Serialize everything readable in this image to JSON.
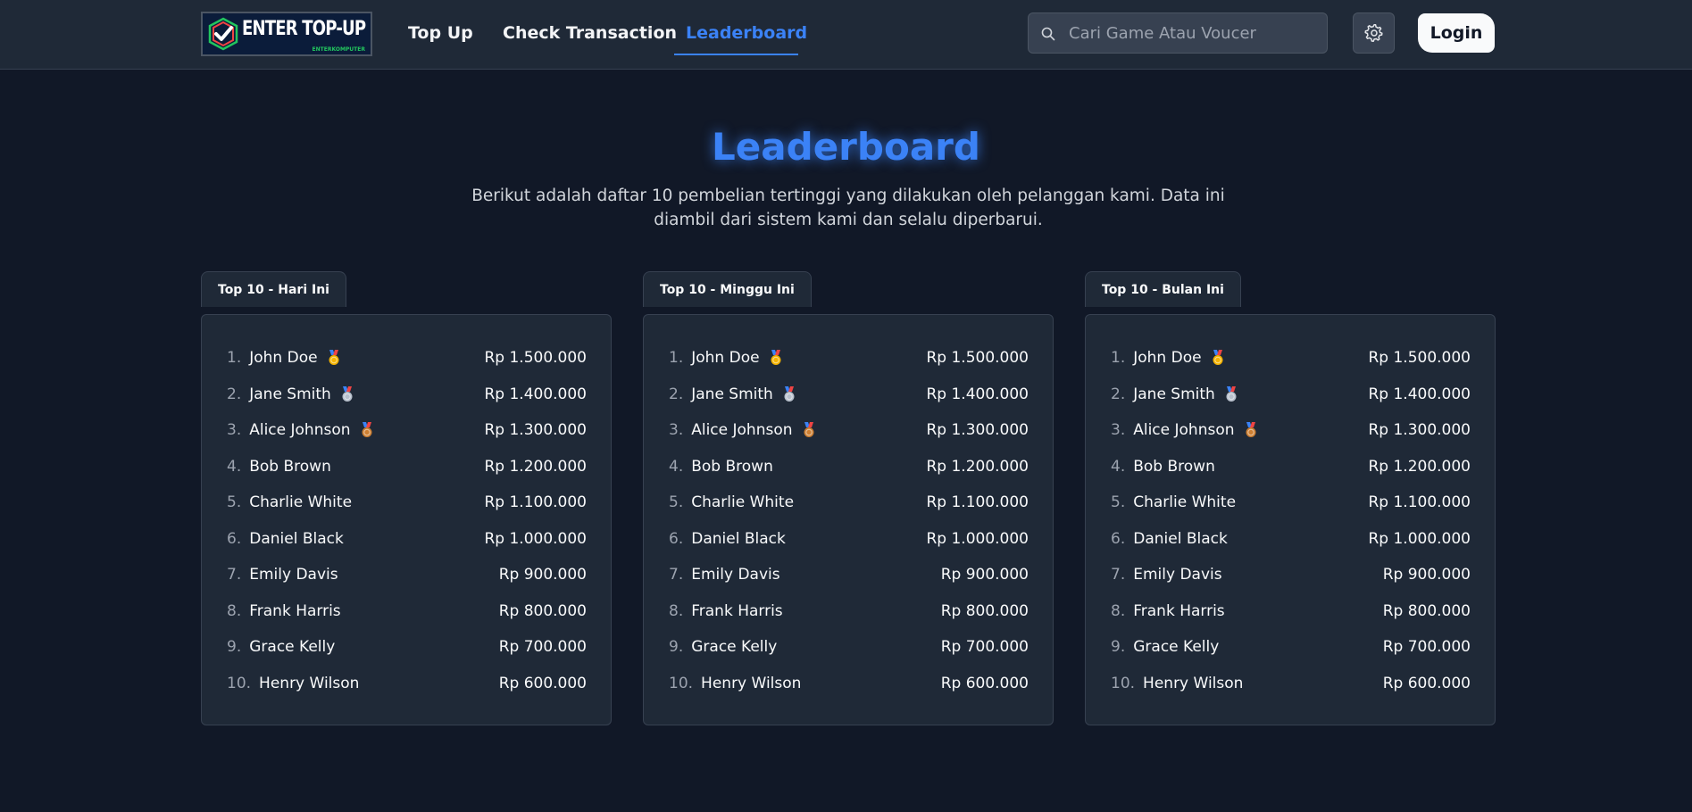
{
  "header": {
    "logo_text": "ENTER TOP-UP",
    "logo_sub": "ENTERKOMPUTER",
    "nav": [
      {
        "label": "Top Up",
        "active": false
      },
      {
        "label": "Check Transaction",
        "active": false
      },
      {
        "label": "Leaderboard",
        "active": true
      }
    ],
    "search_placeholder": "Cari Game Atau Voucer",
    "login_label": "Login"
  },
  "page": {
    "title": "Leaderboard",
    "description": "Berikut adalah daftar 10 pembelian tertinggi yang dilakukan oleh pelanggan kami. Data ini diambil dari sistem kami dan selalu diperbarui."
  },
  "boards": [
    {
      "tab": "Top 10 - Hari Ini",
      "rows": [
        {
          "rank": "1.",
          "name": "John Doe",
          "medal": "gold",
          "amount": "Rp 1.500.000"
        },
        {
          "rank": "2.",
          "name": "Jane Smith",
          "medal": "silver",
          "amount": "Rp 1.400.000"
        },
        {
          "rank": "3.",
          "name": "Alice Johnson",
          "medal": "bronze",
          "amount": "Rp 1.300.000"
        },
        {
          "rank": "4.",
          "name": "Bob Brown",
          "medal": "",
          "amount": "Rp 1.200.000"
        },
        {
          "rank": "5.",
          "name": "Charlie White",
          "medal": "",
          "amount": "Rp 1.100.000"
        },
        {
          "rank": "6.",
          "name": "Daniel Black",
          "medal": "",
          "amount": "Rp 1.000.000"
        },
        {
          "rank": "7.",
          "name": "Emily Davis",
          "medal": "",
          "amount": "Rp 900.000"
        },
        {
          "rank": "8.",
          "name": "Frank Harris",
          "medal": "",
          "amount": "Rp 800.000"
        },
        {
          "rank": "9.",
          "name": "Grace Kelly",
          "medal": "",
          "amount": "Rp 700.000"
        },
        {
          "rank": "10.",
          "name": "Henry Wilson",
          "medal": "",
          "amount": "Rp 600.000"
        }
      ]
    },
    {
      "tab": "Top 10 - Minggu Ini",
      "rows": [
        {
          "rank": "1.",
          "name": "John Doe",
          "medal": "gold",
          "amount": "Rp 1.500.000"
        },
        {
          "rank": "2.",
          "name": "Jane Smith",
          "medal": "silver",
          "amount": "Rp 1.400.000"
        },
        {
          "rank": "3.",
          "name": "Alice Johnson",
          "medal": "bronze",
          "amount": "Rp 1.300.000"
        },
        {
          "rank": "4.",
          "name": "Bob Brown",
          "medal": "",
          "amount": "Rp 1.200.000"
        },
        {
          "rank": "5.",
          "name": "Charlie White",
          "medal": "",
          "amount": "Rp 1.100.000"
        },
        {
          "rank": "6.",
          "name": "Daniel Black",
          "medal": "",
          "amount": "Rp 1.000.000"
        },
        {
          "rank": "7.",
          "name": "Emily Davis",
          "medal": "",
          "amount": "Rp 900.000"
        },
        {
          "rank": "8.",
          "name": "Frank Harris",
          "medal": "",
          "amount": "Rp 800.000"
        },
        {
          "rank": "9.",
          "name": "Grace Kelly",
          "medal": "",
          "amount": "Rp 700.000"
        },
        {
          "rank": "10.",
          "name": "Henry Wilson",
          "medal": "",
          "amount": "Rp 600.000"
        }
      ]
    },
    {
      "tab": "Top 10 - Bulan Ini",
      "rows": [
        {
          "rank": "1.",
          "name": "John Doe",
          "medal": "gold",
          "amount": "Rp 1.500.000"
        },
        {
          "rank": "2.",
          "name": "Jane Smith",
          "medal": "silver",
          "amount": "Rp 1.400.000"
        },
        {
          "rank": "3.",
          "name": "Alice Johnson",
          "medal": "bronze",
          "amount": "Rp 1.300.000"
        },
        {
          "rank": "4.",
          "name": "Bob Brown",
          "medal": "",
          "amount": "Rp 1.200.000"
        },
        {
          "rank": "5.",
          "name": "Charlie White",
          "medal": "",
          "amount": "Rp 1.100.000"
        },
        {
          "rank": "6.",
          "name": "Daniel Black",
          "medal": "",
          "amount": "Rp 1.000.000"
        },
        {
          "rank": "7.",
          "name": "Emily Davis",
          "medal": "",
          "amount": "Rp 900.000"
        },
        {
          "rank": "8.",
          "name": "Frank Harris",
          "medal": "",
          "amount": "Rp 800.000"
        },
        {
          "rank": "9.",
          "name": "Grace Kelly",
          "medal": "",
          "amount": "Rp 700.000"
        },
        {
          "rank": "10.",
          "name": "Henry Wilson",
          "medal": "",
          "amount": "Rp 600.000"
        }
      ]
    }
  ],
  "colors": {
    "accent": "#3b82f6",
    "gold": "#f5b301",
    "silver": "#b8c0cc",
    "bronze": "#cd7f32"
  }
}
